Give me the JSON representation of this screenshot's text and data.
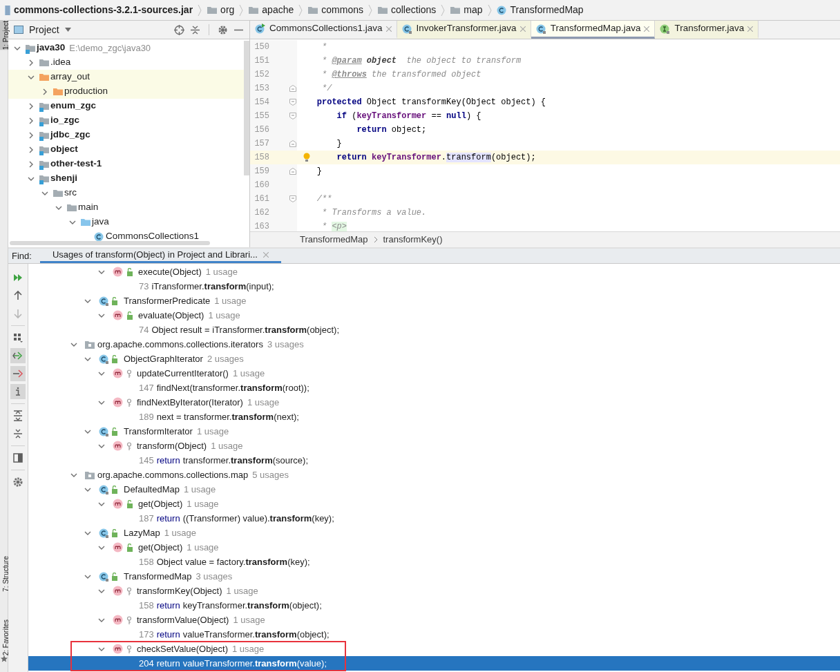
{
  "breadcrumb": [
    {
      "kind": "jar",
      "label": "commons-collections-3.2.1-sources.jar"
    },
    {
      "kind": "folder",
      "label": "org"
    },
    {
      "kind": "folder",
      "label": "apache"
    },
    {
      "kind": "folder",
      "label": "commons"
    },
    {
      "kind": "folder",
      "label": "collections"
    },
    {
      "kind": "folder",
      "label": "map"
    },
    {
      "kind": "class",
      "label": "TransformedMap"
    }
  ],
  "side_strip": [
    {
      "label": "1: Project",
      "selected": true
    },
    {
      "label": "7: Structure",
      "selected": false
    },
    {
      "label": "2: Favorites",
      "selected": false
    }
  ],
  "project": {
    "title": "Project",
    "tree": [
      {
        "kind": "module",
        "name": "java30",
        "path": "E:\\demo_zgc\\java30",
        "expanded": true,
        "children": [
          {
            "kind": "folder",
            "name": ".idea",
            "expanded": false
          },
          {
            "kind": "excluded",
            "name": "array_out",
            "expanded": true,
            "children": [
              {
                "kind": "excluded",
                "name": "production",
                "expanded": false
              }
            ]
          },
          {
            "kind": "module",
            "name": "enum_zgc",
            "expanded": false
          },
          {
            "kind": "module",
            "name": "io_zgc",
            "expanded": false
          },
          {
            "kind": "module",
            "name": "jdbc_zgc",
            "expanded": false
          },
          {
            "kind": "module",
            "name": "object",
            "expanded": false
          },
          {
            "kind": "module",
            "name": "other-test-1",
            "expanded": false
          },
          {
            "kind": "module",
            "name": "shenji",
            "expanded": true,
            "children": [
              {
                "kind": "folder",
                "name": "src",
                "expanded": true,
                "children": [
                  {
                    "kind": "folder",
                    "name": "main",
                    "expanded": true,
                    "children": [
                      {
                        "kind": "source",
                        "name": "java",
                        "expanded": true,
                        "children": [
                          {
                            "kind": "class",
                            "name": "CommonsCollections1"
                          }
                        ]
                      }
                    ]
                  }
                ]
              }
            ]
          }
        ]
      }
    ]
  },
  "editor": {
    "tabs": [
      {
        "kind": "runnable",
        "label": "CommonsCollections1.java",
        "library": false,
        "selected": false
      },
      {
        "kind": "class",
        "label": "InvokerTransformer.java",
        "library": true,
        "selected": false
      },
      {
        "kind": "class",
        "label": "TransformedMap.java",
        "library": true,
        "selected": true
      },
      {
        "kind": "interface",
        "label": "Transformer.java",
        "library": true,
        "selected": false
      }
    ],
    "lines": [
      {
        "number": "150",
        "current": false,
        "fold_start": false,
        "fold_end": false,
        "segments": [
          {
            "text": "     *",
            "kind": "comment"
          }
        ]
      },
      {
        "number": "151",
        "current": false,
        "fold_start": false,
        "fold_end": false,
        "segments": [
          {
            "text": "     * ",
            "kind": "comment"
          },
          {
            "text": "@param",
            "kind": "doctag"
          },
          {
            "text": " object",
            "kind": "docparam"
          },
          {
            "text": "  the object to transform",
            "kind": "comment"
          }
        ]
      },
      {
        "number": "152",
        "current": false,
        "fold_start": false,
        "fold_end": false,
        "segments": [
          {
            "text": "     * ",
            "kind": "comment"
          },
          {
            "text": "@throws",
            "kind": "doctag"
          },
          {
            "text": " the transformed object",
            "kind": "comment"
          }
        ]
      },
      {
        "number": "153",
        "current": false,
        "fold_start": false,
        "fold_end": true,
        "segments": [
          {
            "text": "     */",
            "kind": "comment"
          }
        ]
      },
      {
        "number": "154",
        "current": false,
        "fold_start": true,
        "fold_end": false,
        "segments": [
          {
            "text": "    protected",
            "kind": "keyword"
          },
          {
            "text": " Object transformKey(Object object) {",
            "kind": "plain"
          }
        ]
      },
      {
        "number": "155",
        "current": false,
        "fold_start": true,
        "fold_end": false,
        "segments": [
          {
            "text": "        if",
            "kind": "keyword"
          },
          {
            "text": " (",
            "kind": "plain"
          },
          {
            "text": "keyTransformer",
            "kind": "field"
          },
          {
            "text": " == ",
            "kind": "plain"
          },
          {
            "text": "null",
            "kind": "keyword"
          },
          {
            "text": ") {",
            "kind": "plain"
          }
        ]
      },
      {
        "number": "156",
        "current": false,
        "fold_start": false,
        "fold_end": false,
        "segments": [
          {
            "text": "            return",
            "kind": "keyword"
          },
          {
            "text": " object;",
            "kind": "plain"
          }
        ]
      },
      {
        "number": "157",
        "current": false,
        "fold_start": false,
        "fold_end": true,
        "segments": [
          {
            "text": "        }",
            "kind": "plain"
          }
        ]
      },
      {
        "number": "158",
        "current": true,
        "fold_start": false,
        "fold_end": false,
        "segments": [
          {
            "text": "        return",
            "kind": "keyword"
          },
          {
            "text": " keyTransformer",
            "kind": "field"
          },
          {
            "text": ".",
            "kind": "plain"
          },
          {
            "text": "transform",
            "kind": "match"
          },
          {
            "text": "(object);",
            "kind": "plain"
          }
        ]
      },
      {
        "number": "159",
        "current": false,
        "fold_start": false,
        "fold_end": true,
        "segments": [
          {
            "text": "    }",
            "kind": "plain"
          }
        ]
      },
      {
        "number": "160",
        "current": false,
        "fold_start": false,
        "fold_end": false
      },
      {
        "number": "161",
        "current": false,
        "fold_start": true,
        "fold_end": false,
        "segments": [
          {
            "text": "    /**",
            "kind": "comment"
          }
        ]
      },
      {
        "number": "162",
        "current": false,
        "fold_start": false,
        "fold_end": false,
        "segments": [
          {
            "text": "     * Transforms a value.",
            "kind": "comment"
          }
        ]
      },
      {
        "number": "163",
        "current": false,
        "fold_start": false,
        "fold_end": false,
        "segments": [
          {
            "text": "     * ",
            "kind": "comment"
          },
          {
            "text": "<p>",
            "kind": "html"
          }
        ]
      }
    ],
    "footer": [
      "TransformedMap",
      "transformKey()"
    ]
  },
  "find": {
    "label": "Find:",
    "tab": {
      "label": "Usages of transform(Object) in Project and Librari...",
      "selected": true
    },
    "tools": [
      {
        "kind": "rerun",
        "on": false,
        "disabled": false
      },
      {
        "kind": "up",
        "on": false,
        "disabled": false
      },
      {
        "kind": "down",
        "on": false,
        "disabled": true
      },
      {
        "kind": "group",
        "on": false,
        "disabled": false
      },
      {
        "kind": "read",
        "on": true,
        "disabled": false
      },
      {
        "kind": "write",
        "on": true,
        "disabled": false
      },
      {
        "kind": "info",
        "on": true,
        "disabled": false
      },
      {
        "kind": "expand",
        "on": false,
        "disabled": false
      },
      {
        "kind": "collapse",
        "on": false,
        "disabled": false
      },
      {
        "kind": "preview",
        "on": false,
        "disabled": false
      },
      {
        "kind": "settings",
        "on": false,
        "disabled": false
      }
    ],
    "results": [
      {
        "kind": "method",
        "name": "execute(Object)",
        "public": true,
        "count": "1 usage",
        "expanded": true,
        "framed": false,
        "children": [
          {
            "kind": "usage",
            "line": "73",
            "code": "iTransformer.**transform**(input);",
            "selected": false
          }
        ]
      },
      {
        "kind": "class",
        "name": "TransformerPredicate",
        "public": true,
        "count": "1 usage",
        "expanded": true,
        "children": [
          {
            "kind": "method",
            "name": "evaluate(Object)",
            "public": true,
            "count": "1 usage",
            "expanded": true,
            "framed": false,
            "children": [
              {
                "kind": "usage",
                "line": "74",
                "code": "Object result = iTransformer.**transform**(object);",
                "selected": false
              }
            ]
          }
        ]
      },
      {
        "kind": "package",
        "name": "org.apache.commons.collections.iterators",
        "count": "3 usages",
        "expanded": true,
        "children": [
          {
            "kind": "class",
            "name": "ObjectGraphIterator",
            "public": true,
            "count": "2 usages",
            "expanded": true,
            "children": [
              {
                "kind": "method",
                "name": "updateCurrentIterator()",
                "public": false,
                "count": "1 usage",
                "expanded": true,
                "framed": false,
                "children": [
                  {
                    "kind": "usage",
                    "line": "147",
                    "code": "findNext(transformer.**transform**(root));",
                    "selected": false
                  }
                ]
              },
              {
                "kind": "method",
                "name": "findNextByIterator(Iterator)",
                "public": false,
                "count": "1 usage",
                "expanded": true,
                "framed": false,
                "children": [
                  {
                    "kind": "usage",
                    "line": "189",
                    "code": "next = transformer.**transform**(next);",
                    "selected": false
                  }
                ]
              }
            ]
          },
          {
            "kind": "class",
            "name": "TransformIterator",
            "public": true,
            "count": "1 usage",
            "expanded": true,
            "children": [
              {
                "kind": "method",
                "name": "transform(Object)",
                "public": false,
                "count": "1 usage",
                "expanded": true,
                "framed": false,
                "children": [
                  {
                    "kind": "usage",
                    "line": "145",
                    "keyword": "return",
                    "code": "transformer.**transform**(source);",
                    "selected": false
                  }
                ]
              }
            ]
          }
        ]
      },
      {
        "kind": "package",
        "name": "org.apache.commons.collections.map",
        "count": "5 usages",
        "expanded": true,
        "children": [
          {
            "kind": "class",
            "name": "DefaultedMap",
            "public": true,
            "count": "1 usage",
            "expanded": true,
            "children": [
              {
                "kind": "method",
                "name": "get(Object)",
                "public": true,
                "count": "1 usage",
                "expanded": true,
                "framed": false,
                "children": [
                  {
                    "kind": "usage",
                    "line": "187",
                    "keyword": "return",
                    "code": "((Transformer) value).**transform**(key);",
                    "selected": false
                  }
                ]
              }
            ]
          },
          {
            "kind": "class",
            "name": "LazyMap",
            "public": true,
            "count": "1 usage",
            "expanded": true,
            "children": [
              {
                "kind": "method",
                "name": "get(Object)",
                "public": true,
                "count": "1 usage",
                "expanded": true,
                "framed": false,
                "children": [
                  {
                    "kind": "usage",
                    "line": "158",
                    "code": "Object value = factory.**transform**(key);",
                    "selected": false
                  }
                ]
              }
            ]
          },
          {
            "kind": "class",
            "name": "TransformedMap",
            "public": true,
            "count": "3 usages",
            "expanded": true,
            "children": [
              {
                "kind": "method",
                "name": "transformKey(Object)",
                "public": false,
                "count": "1 usage",
                "expanded": true,
                "framed": false,
                "children": [
                  {
                    "kind": "usage",
                    "line": "158",
                    "keyword": "return",
                    "code": "keyTransformer.**transform**(object);",
                    "selected": false
                  }
                ]
              },
              {
                "kind": "method",
                "name": "transformValue(Object)",
                "public": false,
                "count": "1 usage",
                "expanded": true,
                "framed": false,
                "children": [
                  {
                    "kind": "usage",
                    "line": "173",
                    "keyword": "return",
                    "code": "valueTransformer.**transform**(object);",
                    "selected": false
                  }
                ]
              },
              {
                "kind": "method",
                "name": "checkSetValue(Object)",
                "public": false,
                "count": "1 usage",
                "expanded": true,
                "framed": true,
                "children": [
                  {
                    "kind": "usage",
                    "line": "204",
                    "keyword": "return",
                    "code": "valueTransformer.**transform**(value);",
                    "selected": true
                  }
                ]
              }
            ]
          }
        ]
      }
    ]
  }
}
